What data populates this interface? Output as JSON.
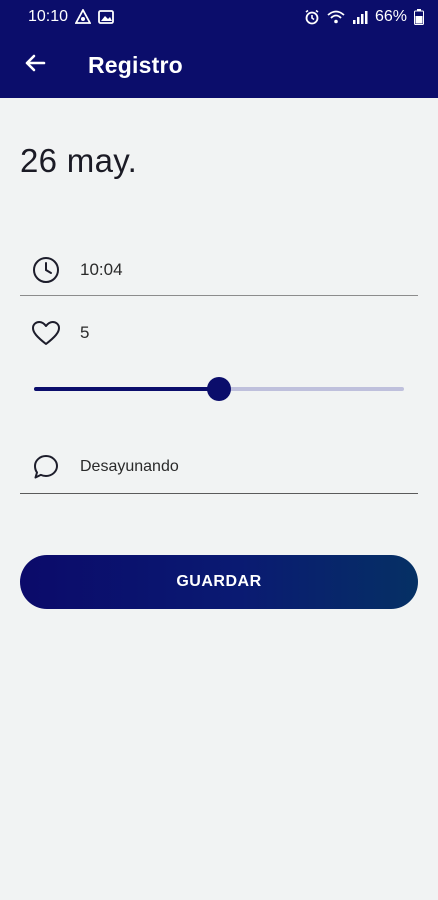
{
  "status_bar": {
    "time": "10:10",
    "battery": "66%",
    "left_icons": [
      "sync-icon",
      "image-icon"
    ],
    "right_icons": [
      "alarm-icon",
      "wifi-icon",
      "signal-icon",
      "battery-icon"
    ]
  },
  "app_bar": {
    "title": "Registro",
    "back_icon": "arrow-left-icon",
    "background": "#0b0d6b"
  },
  "entry": {
    "date": "26 may.",
    "time": "10:04",
    "mood_value": "5",
    "mood_slider_fraction": 0.5,
    "note": "Desayunando"
  },
  "actions": {
    "save_label": "GUARDAR"
  },
  "colors": {
    "primary": "#0b0d6b",
    "slider_inactive": "#bfc0dc",
    "background": "#f1f3f3"
  }
}
